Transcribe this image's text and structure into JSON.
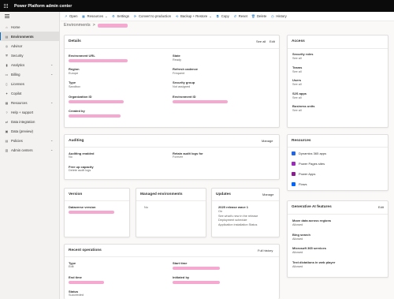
{
  "app": {
    "title": "Power Platform admin center"
  },
  "sidebar": {
    "items": [
      {
        "label": "Home",
        "icon": "home-icon",
        "glyph": "⌂",
        "chevron": false,
        "active": false
      },
      {
        "label": "Environments",
        "icon": "environments-icon",
        "glyph": "▤",
        "chevron": false,
        "active": true
      },
      {
        "label": "Advisor",
        "icon": "advisor-icon",
        "glyph": "◎",
        "chevron": false,
        "active": false
      },
      {
        "label": "Security",
        "icon": "shield-icon",
        "glyph": "⛨",
        "chevron": false,
        "active": false
      },
      {
        "label": "Analytics",
        "icon": "analytics-icon",
        "glyph": "▮",
        "chevron": true,
        "active": false
      },
      {
        "label": "Billing",
        "icon": "billing-icon",
        "glyph": "▭",
        "chevron": true,
        "active": false
      },
      {
        "label": "Licenses",
        "icon": "licenses-icon",
        "glyph": "▯",
        "chevron": false,
        "active": false
      },
      {
        "label": "Copilot",
        "icon": "copilot-icon",
        "glyph": "✦",
        "chevron": false,
        "active": false
      },
      {
        "label": "Resources",
        "icon": "resources-icon",
        "glyph": "▦",
        "chevron": true,
        "active": false
      },
      {
        "label": "Help + support",
        "icon": "help-icon",
        "glyph": "?",
        "chevron": false,
        "active": false
      },
      {
        "label": "Data integration",
        "icon": "data-integration-icon",
        "glyph": "⇄",
        "chevron": false,
        "active": false
      },
      {
        "label": "Data (preview)",
        "icon": "data-icon",
        "glyph": "▣",
        "chevron": false,
        "active": false
      },
      {
        "label": "Policies",
        "icon": "policies-icon",
        "glyph": "▤",
        "chevron": true,
        "active": false
      },
      {
        "label": "Admin centers",
        "icon": "admin-centers-icon",
        "glyph": "▥",
        "chevron": true,
        "active": false
      }
    ]
  },
  "commands": [
    {
      "label": "Open",
      "icon": "open-icon",
      "glyph": "↗"
    },
    {
      "label": "Resources",
      "icon": "resources-icon",
      "glyph": "▦",
      "chevron": "⌄"
    },
    {
      "label": "Settings",
      "icon": "gear-icon",
      "glyph": "⚙"
    },
    {
      "label": "Convert to production",
      "icon": "convert-icon",
      "glyph": "⟳"
    },
    {
      "label": "Backup + Restore",
      "icon": "backup-icon",
      "glyph": "⟲",
      "chevron": "⌄"
    },
    {
      "label": "Copy",
      "icon": "copy-icon",
      "glyph": "⧉"
    },
    {
      "label": "Reset",
      "icon": "reset-icon",
      "glyph": "↺"
    },
    {
      "label": "Delete",
      "icon": "delete-icon",
      "glyph": "🗑"
    },
    {
      "label": "History",
      "icon": "history-icon",
      "glyph": "◷"
    }
  ],
  "breadcrumb": {
    "root": "Environments",
    "separator": ">"
  },
  "details": {
    "title": "Details",
    "see_all": "See all",
    "edit": "Edit",
    "fields": {
      "env_url_label": "Environment URL",
      "state_label": "State",
      "state_value": "Ready",
      "region_label": "Region",
      "region_value": "Europe",
      "refresh_label": "Refresh cadence",
      "refresh_value": "Frequent",
      "type_label": "Type",
      "type_value": "Sandbox",
      "secgroup_label": "Security group",
      "secgroup_value": "Not assigned",
      "org_label": "Organization ID",
      "envid_label": "Environment ID",
      "createdby_label": "Created by"
    }
  },
  "auditing": {
    "title": "Auditing",
    "manage": "Manage",
    "enabled_label": "Auditing enabled",
    "enabled_value": "No",
    "retain_label": "Retain audit logs for",
    "retain_value": "Forever",
    "free_label": "Free up capacity",
    "free_value": "Delete audit logs"
  },
  "version": {
    "title": "Version",
    "dataverse_label": "Dataverse version"
  },
  "managed": {
    "title": "Managed environments",
    "value": "No"
  },
  "updates": {
    "title": "Updates",
    "manage": "Manage",
    "heading": "2025 release wave 1",
    "lines": [
      "On",
      "See what's new in the release",
      "Deployment schedule",
      "Application installation Status"
    ]
  },
  "recent": {
    "title": "Recent operations",
    "full_history": "Full history",
    "type_label": "Type",
    "type_value": "Edit",
    "start_label": "Start time",
    "end_label": "End time",
    "initiated_label": "Initiated by",
    "status_label": "Status",
    "status_value": "Succeeded"
  },
  "access": {
    "title": "Access",
    "items": [
      {
        "label": "Security roles",
        "link": "See all"
      },
      {
        "label": "Teams",
        "link": "See all"
      },
      {
        "label": "Users",
        "link": "See all"
      },
      {
        "label": "S2S apps",
        "link": "See all"
      },
      {
        "label": "Business units",
        "link": "See all"
      }
    ]
  },
  "resources": {
    "title": "Resources",
    "items": [
      {
        "label": "Dynamics 365 apps",
        "icon": "dynamics-365-icon",
        "color": "#2266e3"
      },
      {
        "label": "Power Pages sites",
        "icon": "power-pages-icon",
        "color": "#9b2bb9"
      },
      {
        "label": "Power Apps",
        "icon": "power-apps-icon",
        "color": "#8a1e8f"
      },
      {
        "label": "Flows",
        "icon": "flows-icon",
        "color": "#0066ff"
      }
    ]
  },
  "genai": {
    "title": "Generative AI features",
    "edit": "Edit",
    "items": [
      {
        "label": "Move data across regions",
        "value": "Allowed"
      },
      {
        "label": "Bing search",
        "value": "Allowed"
      },
      {
        "label": "Microsoft 365 services",
        "value": "Allowed"
      },
      {
        "label": "Text dictations in web player",
        "value": "Allowed"
      }
    ]
  },
  "colors": {
    "accent": "#0f6cbd",
    "topbar": "#0b0b0b",
    "redaction": "#f5a9d0"
  }
}
